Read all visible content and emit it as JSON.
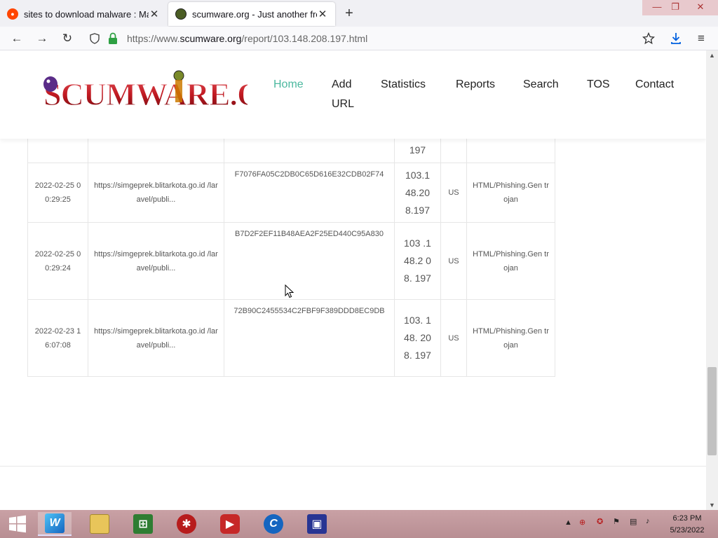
{
  "browser": {
    "tabs": [
      {
        "title": "sites to download malware : Malw",
        "favicon": "reddit-icon",
        "active": false
      },
      {
        "title": "scumware.org - Just another free a",
        "favicon": "scumware-icon",
        "active": true
      }
    ],
    "url_prefix": "https://www.",
    "url_domain": "scumware.org",
    "url_path": "/report/103.148.208.197.html"
  },
  "site": {
    "logo_text": "SCUMWARE.ORG",
    "menu": [
      "Home",
      "Add URL",
      "Statistics",
      "Reports",
      "Search",
      "TOS",
      "Contact"
    ],
    "active_menu": "Home",
    "accent_color": "#4cb89f"
  },
  "table": {
    "partial_row": {
      "ip": "197"
    },
    "rows": [
      {
        "date": "2022-02-25 00:29:25",
        "url": "https://simgeprek.blitarkota.go.id /laravel/publi...",
        "hash": "F7076FA05C2DB0C65D616E32CDB02F74",
        "ip": "103.1 48.20 8.197",
        "country": "US",
        "detection": "HTML/Phishing.Gen trojan"
      },
      {
        "date": "2022-02-25 00:29:24",
        "url": "https://simgeprek.blitarkota.go.id /laravel/publi...",
        "hash": "B7D2F2EF11B48AEA2F25ED440C95A830",
        "ip": "103 .148.2 08. 197",
        "country": "US",
        "detection": "HTML/Phishing.Gen trojan"
      },
      {
        "date": "2022-02-23 16:07:08",
        "url": "https://simgeprek.blitarkota.go.id /laravel/publi...",
        "hash": "72B90C2455534C2FBF9F389DDD8EC9DB",
        "ip": "103. 148. 208. 197",
        "country": "US",
        "detection": "HTML/Phishing.Gen trojan"
      }
    ]
  },
  "taskbar": {
    "time": "6:23 PM",
    "date": "5/23/2022"
  }
}
